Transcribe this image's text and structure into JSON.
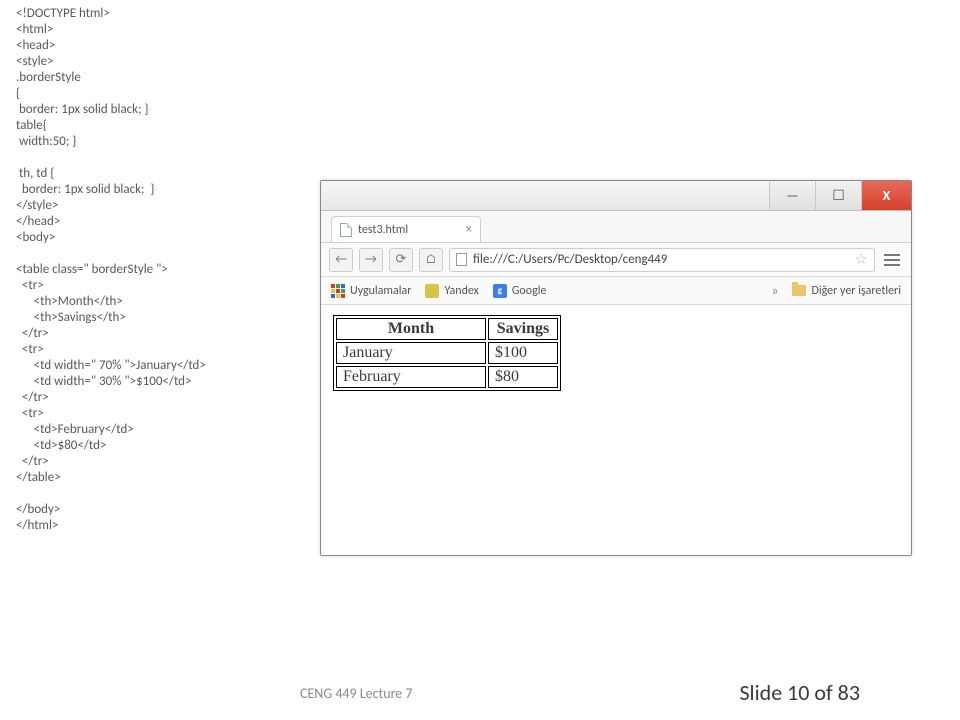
{
  "code": "<!DOCTYPE html>\n<html>\n<head>\n<style>\n.borderStyle\n{\n border: 1px solid black; }\ntable{\n width:50; }\n\n th, td {\n  border: 1px solid black;  }\n</style>\n</head>\n<body>\n\n<table class=\" borderStyle \">\n  <tr>\n      <th>Month</th>\n      <th>Savings</th>\n  </tr>\n  <tr>\n      <td width=\" 70% \">January</td>\n      <td width=\" 30% \">$100</td>\n  </tr>\n  <tr>\n      <td>February</td>\n      <td>$80</td>\n  </tr>\n</table>\n\n</body>\n</html>",
  "browser": {
    "tab_title": "test3.html",
    "url": "file:///C:/Users/Pc/Desktop/ceng449",
    "bookmarks": {
      "apps": "Uygulamalar",
      "yandex": "Yandex",
      "google": "Google",
      "other": "Diğer yer işaretleri",
      "google_glyph": "g"
    }
  },
  "rendered_table": {
    "headers": [
      "Month",
      "Savings"
    ],
    "rows": [
      [
        "January",
        "$100"
      ],
      [
        "February",
        "$80"
      ]
    ]
  },
  "footer": {
    "left": "CENG 449 Lecture 7",
    "right": "Slide 10 of 83"
  },
  "icons": {
    "min": "—",
    "max": "☐",
    "close": "X",
    "back": "←",
    "fwd": "→",
    "reload": "⟳",
    "home": "⌂",
    "star": "☆",
    "chev": "»",
    "tabx": "×"
  }
}
